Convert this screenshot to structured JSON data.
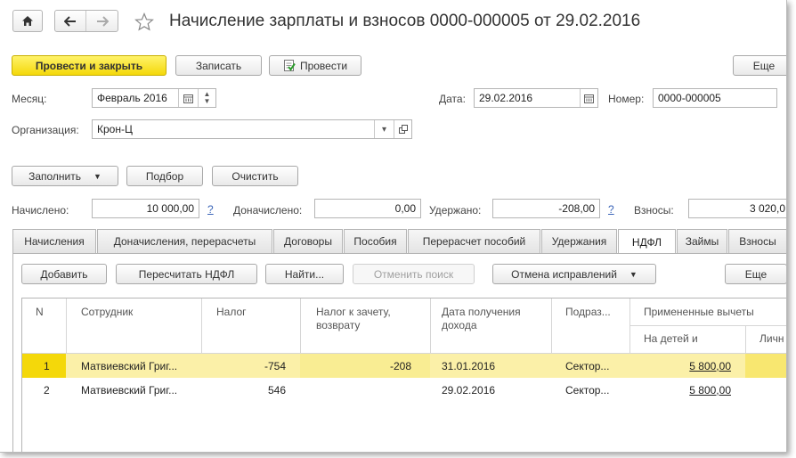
{
  "header": {
    "title": "Начисление зарплаты и взносов 0000-000005 от 29.02.2016"
  },
  "toolbar": {
    "post_close": "Провести и закрыть",
    "save": "Записать",
    "post": "Провести",
    "more": "Еще"
  },
  "form": {
    "month_label": "Месяц:",
    "month_value": "Февраль 2016",
    "date_label": "Дата:",
    "date_value": "29.02.2016",
    "number_label": "Номер:",
    "number_value": "0000-000005",
    "org_label": "Организация:",
    "org_value": "Крон-Ц"
  },
  "actions": {
    "fill": "Заполнить",
    "select": "Подбор",
    "clear": "Очистить"
  },
  "totals": {
    "accrued_label": "Начислено:",
    "accrued_value": "10 000,00",
    "extra_label": "Доначислено:",
    "extra_value": "0,00",
    "withheld_label": "Удержано:",
    "withheld_value": "-208,00",
    "contrib_label": "Взносы:",
    "contrib_value": "3 020,0",
    "help": "?"
  },
  "tabs": [
    {
      "label": "Начисления"
    },
    {
      "label": "Доначисления, перерасчеты"
    },
    {
      "label": "Договоры"
    },
    {
      "label": "Пособия"
    },
    {
      "label": "Перерасчет пособий"
    },
    {
      "label": "Удержания"
    },
    {
      "label": "НДФЛ"
    },
    {
      "label": "Займы"
    },
    {
      "label": "Взносы"
    }
  ],
  "panel_toolbar": {
    "add": "Добавить",
    "recalc": "Пересчитать НДФЛ",
    "find": "Найти...",
    "cancel_search": "Отменить поиск",
    "cancel_fix": "Отмена исправлений",
    "more": "Еще"
  },
  "table": {
    "columns": {
      "n": "N",
      "employee": "Сотрудник",
      "tax": "Налог",
      "tax_offset": "Налог к зачету, возврату",
      "income_date": "Дата получения дохода",
      "division": "Подраз...",
      "deductions": "Примененные вычеты",
      "for_children": "На детей и",
      "personal": "Личн"
    },
    "rows": [
      {
        "n": "1",
        "employee": "Матвиевский Григ...",
        "tax": "-754",
        "tax_offset": "-208",
        "income_date": "31.01.2016",
        "division": "Сектор...",
        "for_children": "5 800,00"
      },
      {
        "n": "2",
        "employee": "Матвиевский Григ...",
        "tax": "546",
        "tax_offset": "",
        "income_date": "29.02.2016",
        "division": "Сектор...",
        "for_children": "5 800,00"
      }
    ]
  },
  "colors": {
    "primary_button": "#f4d80a",
    "selected_row": "#fbf0a8",
    "link": "#3a64b8"
  }
}
